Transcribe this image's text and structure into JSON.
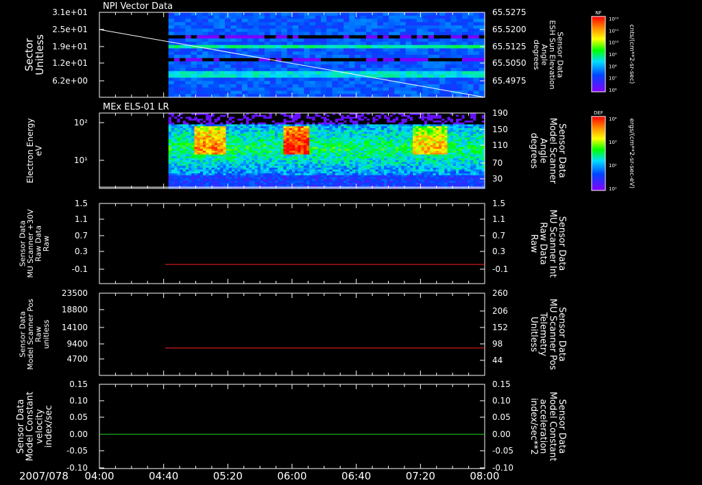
{
  "colors": {
    "background": "#000000",
    "axis": "#ffffff",
    "red_trace": "#ff2020",
    "green_trace": "#22dd22",
    "white_trace": "#ffffff"
  },
  "chart_data": [
    {
      "type": "heatmap",
      "title": "NPI Vector Data",
      "ylabel": "Sector\nUnitless",
      "y_ticks": [
        "3.1e+01",
        "2.5e+01",
        "1.9e+01",
        "1.2e+01",
        "6.2e+00"
      ],
      "right_ylabel": "Sensor Data\nESH Sun Elevation\nAngle\ndegrees",
      "right_ticks": [
        "65.5275",
        "65.5200",
        "65.5125",
        "65.5050",
        "65.4975"
      ],
      "colorbar": {
        "label": "NF",
        "units": "cnts/(cm**2-sr-sec)",
        "ticks": [
          "10¹²",
          "10¹¹",
          "10¹⁰",
          "10⁹",
          "10⁸",
          "10⁷",
          "10⁶"
        ]
      },
      "data_start": "04:43",
      "overlay_line": {
        "start": [
          "04:00",
          65.5233
        ],
        "end": [
          "08:00",
          65.4969
        ]
      }
    },
    {
      "type": "heatmap",
      "title": "MEx ELS-01 LR",
      "ylabel": "Electron Energy\neV",
      "y_ticks": [
        "10²",
        "10¹"
      ],
      "right_ylabel": "Sensor Data\nModel Scanner\nAngle\ndegrees",
      "right_ticks": [
        "190",
        "150",
        "110",
        "70",
        "30"
      ],
      "colorbar": {
        "label": "DEF",
        "units": "ergs/(cm**2-sr-sec-eV)",
        "ticks": [
          "10⁴",
          "10³",
          "10²",
          "10¹"
        ]
      },
      "data_start": "04:43",
      "overlay_line": {
        "value": 13
      }
    },
    {
      "type": "line",
      "ylabel": "Sensor Data\nMU Scanner +30V\nRaw Data\nRaw",
      "y_ticks": [
        "1.5",
        "1.1",
        "0.7",
        "0.3",
        "-0.1"
      ],
      "ylim": [
        -0.3,
        1.5
      ],
      "right_ylabel": "Sensor Data\nMU Scanner Int\nRaw Data\nRaw",
      "right_ticks": [
        "1.5",
        "1.1",
        "0.7",
        "0.3",
        "-0.1"
      ],
      "series": [
        {
          "x": [
            "04:41",
            "08:00"
          ],
          "y": [
            -0.07,
            -0.07
          ]
        }
      ]
    },
    {
      "type": "line",
      "ylabel": "Sensor Data\nModel Scanner Pos\nRaw\nunitless",
      "y_ticks": [
        "23500",
        "18800",
        "14100",
        "9400",
        "4700"
      ],
      "ylim": [
        0,
        23500
      ],
      "right_ylabel": "Sensor Data\nMU Scanner Pos\nTelemetry\nUnitless",
      "right_ticks": [
        "260",
        "206",
        "152",
        "98",
        "44"
      ],
      "series": [
        {
          "x": [
            "04:41",
            "08:00"
          ],
          "y": [
            8200,
            8200
          ]
        }
      ]
    },
    {
      "type": "line",
      "ylabel": "Sensor Data\nModel Constant\nvelocity\nindex/sec",
      "y_ticks": [
        "0.15",
        "0.10",
        "0.05",
        "0.00",
        "-0.05",
        "-0.10"
      ],
      "ylim": [
        -0.1,
        0.15
      ],
      "right_ylabel": "Sensor Data\nModel Constant\nacceleration\nindex/sec**2",
      "right_ticks": [
        "0.15",
        "0.10",
        "0.05",
        "0.00",
        "-0.05",
        "-0.10"
      ],
      "series": [
        {
          "x": [
            "04:00",
            "08:00"
          ],
          "y": [
            0.0,
            0.0
          ]
        }
      ]
    }
  ],
  "x_axis": {
    "date": "2007/078",
    "ticks": [
      "04:00",
      "04:40",
      "05:20",
      "06:00",
      "06:40",
      "07:20",
      "08:00"
    ],
    "range": [
      "04:00",
      "08:00"
    ]
  }
}
